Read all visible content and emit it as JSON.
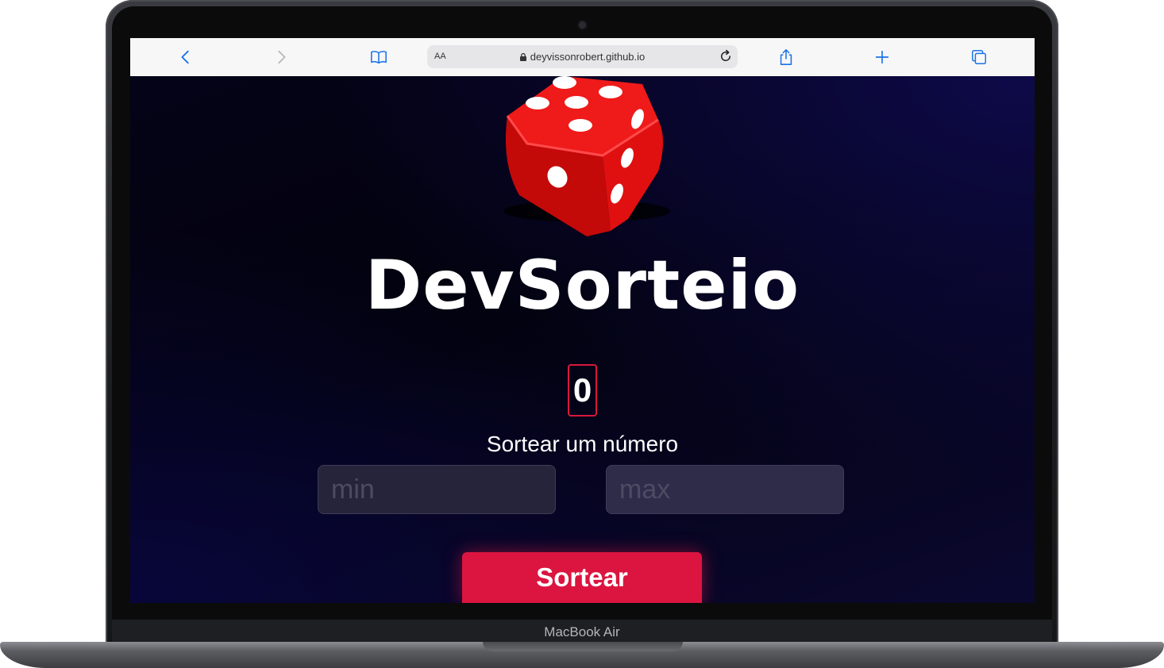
{
  "device": {
    "label": "MacBook Air"
  },
  "browser": {
    "reader_label": "AA",
    "url": "deyvissonrobert.github.io",
    "icons": [
      "back-icon",
      "forward-icon",
      "bookmarks-icon",
      "lock-icon",
      "reload-icon",
      "share-icon",
      "new-tab-icon",
      "tabs-icon"
    ],
    "accent_color": "#1a73e8"
  },
  "page": {
    "title": "DevSorteio",
    "result": "0",
    "subtitle": "Sortear um número",
    "min_placeholder": "min",
    "max_placeholder": "max",
    "button_label": "Sortear",
    "colors": {
      "accent": "#db1540",
      "background": "#050318",
      "input": "#2b2841"
    },
    "logo_icon": "dice-icon"
  }
}
